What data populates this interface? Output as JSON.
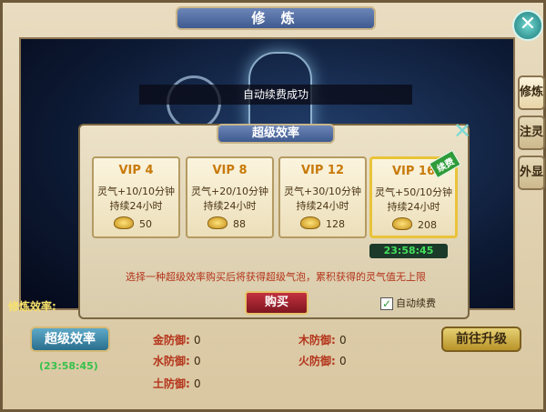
{
  "window": {
    "title": "修 炼",
    "close_icon": "close-icon"
  },
  "scene": {
    "toast": "自动续费成功"
  },
  "side_tabs": [
    {
      "label": "修炼",
      "active": true
    },
    {
      "label": "注灵",
      "active": false
    },
    {
      "label": "外显",
      "active": false
    }
  ],
  "stats": {
    "cultivation_efficiency_label": "修炼效率:",
    "super_efficiency_button": "超级效率",
    "left_timer": "(23:58:45)",
    "goto_upgrade_button": "前往升级",
    "defenses": [
      {
        "label": "金防御",
        "value": "0"
      },
      {
        "label": "木防御",
        "value": "0"
      },
      {
        "label": "水防御",
        "value": "0"
      },
      {
        "label": "火防御",
        "value": "0"
      },
      {
        "label": "土防御",
        "value": "0"
      }
    ]
  },
  "modal": {
    "title": "超级效率",
    "options": [
      {
        "vip": "VIP 4",
        "line1": "灵气+10/10分钟",
        "line2": "持续24小时",
        "price": "50",
        "selected": false,
        "badge": ""
      },
      {
        "vip": "VIP 8",
        "line1": "灵气+20/10分钟",
        "line2": "持续24小时",
        "price": "88",
        "selected": false,
        "badge": ""
      },
      {
        "vip": "VIP 12",
        "line1": "灵气+30/10分钟",
        "line2": "持续24小时",
        "price": "128",
        "selected": false,
        "badge": ""
      },
      {
        "vip": "VIP 16",
        "line1": "灵气+50/10分钟",
        "line2": "持续24小时",
        "price": "208",
        "selected": true,
        "badge": "续费"
      }
    ],
    "selected_timer": "23:58:45",
    "hint": "选择一种超级效率购买后将获得超级气泡，累积获得的灵气值无上限",
    "buy_button": "购买",
    "auto_renew_label": "自动续费",
    "auto_renew_checked": true
  }
}
